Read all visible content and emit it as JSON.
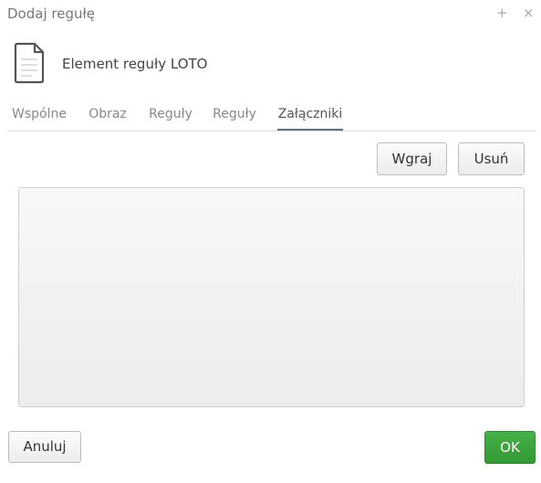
{
  "window": {
    "title": "Dodaj regułę",
    "plus_glyph": "+",
    "close_glyph": "×"
  },
  "element": {
    "icon": "document-icon",
    "name": "Element reguły LOTO"
  },
  "tabs": [
    {
      "label": "Wspólne"
    },
    {
      "label": "Obraz"
    },
    {
      "label": "Reguły"
    },
    {
      "label": "Reguły"
    },
    {
      "label": "Załączniki",
      "active": true
    }
  ],
  "attachments": {
    "upload_label": "Wgraj",
    "delete_label": "Usuń",
    "items": []
  },
  "footer": {
    "cancel_label": "Anuluj",
    "ok_label": "OK"
  },
  "colors": {
    "ok_button": "#3aa33a",
    "active_tab_underline": "#5a6c86"
  }
}
